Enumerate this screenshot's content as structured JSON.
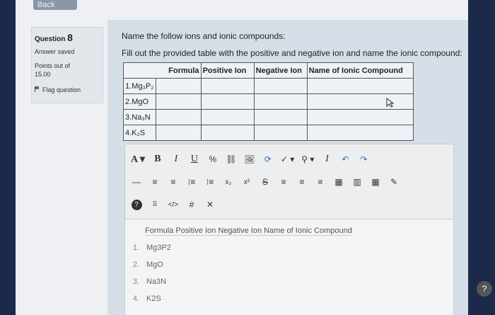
{
  "nav": {
    "back_label": "Back"
  },
  "question_info": {
    "prefix": "Question",
    "number": "8",
    "status": "Answer saved",
    "points_label": "Points out of",
    "points_value": "15.00",
    "flag_label": "Flag question"
  },
  "question": {
    "line1": "Name the follow ions and ionic compounds:",
    "line2": "Fill out the provided table with the positive and negative ion and name the ionic compound:",
    "table": {
      "headers": [
        "Formula",
        "Positive Ion",
        "Negative Ion",
        "Name of Ionic Compound"
      ],
      "rows": [
        {
          "num": "1.",
          "formula": "Mg₃P₂"
        },
        {
          "num": "2.",
          "formula": "MgO"
        },
        {
          "num": "3.",
          "formula": "Na₃N"
        },
        {
          "num": "4.",
          "formula": "K₂S"
        }
      ]
    }
  },
  "editor": {
    "toolbar1": [
      "A ▾",
      "B",
      "I",
      "U",
      "%",
      "⛓",
      "🖼",
      "⟳",
      "✓ ▾",
      "⚲ ▾",
      "I",
      "↶",
      "↷"
    ],
    "toolbar2": [
      "—",
      "≡",
      "≡",
      "⁝≡",
      "⁝≡",
      "x₂",
      "x²",
      "S",
      "≡",
      "≡",
      "≡",
      "▦",
      "▥",
      "▦",
      "✎"
    ],
    "toolbar3": [
      "?",
      "⠿",
      "</>",
      "#",
      "✕"
    ],
    "answer_header": "Formula Positive Ion Negative Ion Name of Ionic Compound",
    "answer_rows": [
      {
        "num": "1.",
        "val": "Mg3P2"
      },
      {
        "num": "2.",
        "val": "MgO"
      },
      {
        "num": "3.",
        "val": "Na3N"
      },
      {
        "num": "4.",
        "val": "K2S"
      }
    ]
  },
  "help_label": "?"
}
